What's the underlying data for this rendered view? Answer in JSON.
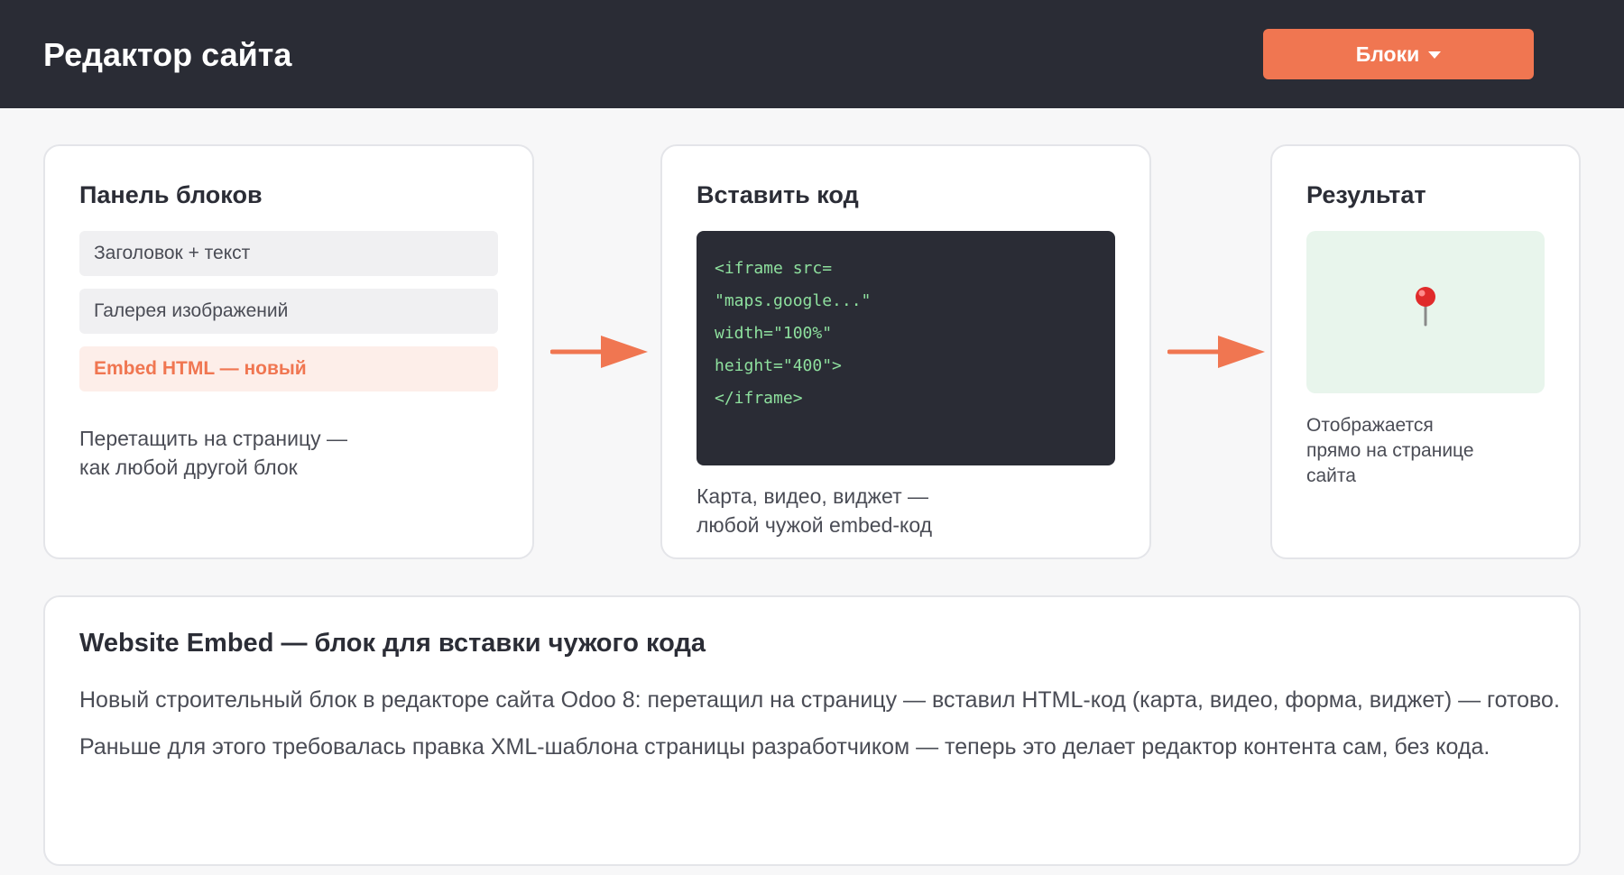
{
  "header": {
    "title": "Редактор сайта",
    "blocks_button": "Блоки",
    "blocks_icon": "chevron-down-icon"
  },
  "colors": {
    "accent": "#f07651",
    "header_bg": "#2a2c35",
    "code_text": "#8ee09e",
    "map_bg": "#e8f5ec"
  },
  "blocks_panel": {
    "title": "Панель блоков",
    "items": [
      {
        "label": "Заголовок + текст",
        "active": false
      },
      {
        "label": "Галерея изображений",
        "active": false
      },
      {
        "label": "Embed HTML — новый",
        "active": true
      }
    ],
    "description_line1": "Перетащить на страницу —",
    "description_line2": "как любой другой блок"
  },
  "code_panel": {
    "title": "Вставить код",
    "code_lines": [
      "<iframe src=",
      "\"maps.google...\"",
      "width=\"100%\"",
      "height=\"400\">",
      "</iframe>"
    ],
    "description_line1": "Карта, видео, виджет —",
    "description_line2": "любой чужой embed-код"
  },
  "result_panel": {
    "title": "Результат",
    "map_icon": "map-pin-icon",
    "description_line1": "Отображается",
    "description_line2": "прямо на странице",
    "description_line3": "сайта"
  },
  "info": {
    "title": "Website Embed — блок для вставки чужого кода",
    "paragraph1": "Новый строительный блок в редакторе сайта Odoo 8: перетащил на страницу — вставил HTML-код (карта, видео, форма, виджет) — готово.",
    "paragraph2": "Раньше для этого требовалась правка XML-шаблона страницы разработчиком — теперь это делает редактор контента сам, без кода."
  }
}
